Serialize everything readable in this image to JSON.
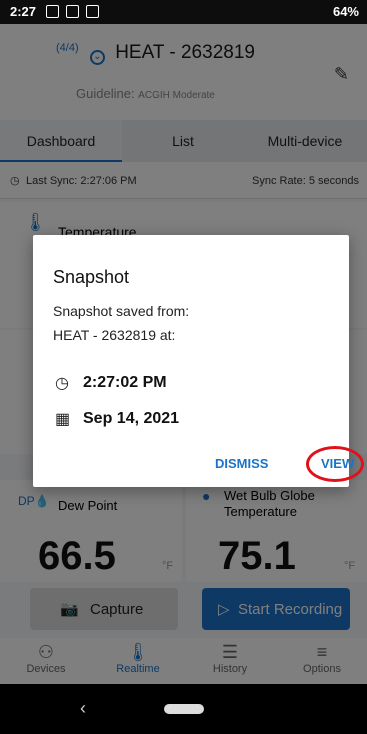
{
  "status_bar": {
    "time": "2:27",
    "right": "64%"
  },
  "header": {
    "index": "(4/4)",
    "title": "HEAT - 2632819",
    "guideline_label": "Guideline:",
    "guideline_value": "ACGIH Moderate"
  },
  "tabs": [
    "Dashboard",
    "List",
    "Multi-device"
  ],
  "sync": {
    "last_sync": "Last Sync: 2:27:06 PM",
    "rate": "Sync Rate: 5 seconds"
  },
  "cards": {
    "temperature_label": "Temperature",
    "dew_point_label": "Dew Point",
    "dew_point_value": "66.5",
    "wbgt_label": "Wet Bulb Globe Temperature",
    "wbgt_value": "75.1",
    "unit": "°F"
  },
  "actions": {
    "capture": "Capture",
    "start_recording": "Start Recording"
  },
  "bottom_nav": [
    "Devices",
    "Realtime",
    "History",
    "Options"
  ],
  "dialog": {
    "title": "Snapshot",
    "line1": "Snapshot saved from:",
    "line2": "HEAT - 2632819 at:",
    "time": "2:27:02 PM",
    "date": "Sep 14, 2021",
    "dismiss": "DISMISS",
    "view": "VIEW"
  }
}
